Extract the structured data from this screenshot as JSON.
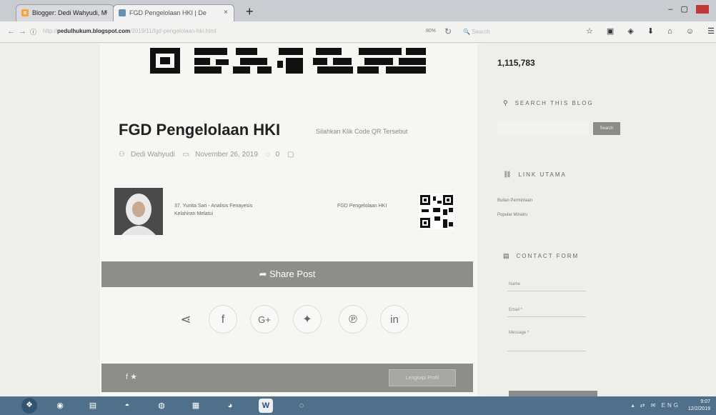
{
  "browser": {
    "tabs": [
      {
        "label": "Blogger: Dedi Wahyudi, M"
      },
      {
        "label": "FGD Pengelolaan HKI | De"
      }
    ],
    "new_tab": "+",
    "url_host": "pedulhukum.blogspot.com",
    "url_path": "/2019/11/fgd-pengelolaan-hki.html",
    "url_prefix": "http://",
    "zoom": "80%",
    "search_placeholder": "Search"
  },
  "post": {
    "title": "FGD Pengelolaan HKI",
    "qr_hint": "Silahkan Klik Code QR Tersebut",
    "author": "Dedi Wahyudi",
    "date": "November 26, 2019",
    "comments": "0",
    "related": [
      {
        "title": "37. Yunita Sari - Analisis Fenayesis Kelahiran Melatui"
      },
      {
        "title": "FGD Pengelolaan HKI"
      }
    ],
    "share_label": "Share Post",
    "profile_button": "Lengkapi Profil"
  },
  "share_icons": [
    {
      "name": "share-icon",
      "glyph": "<"
    },
    {
      "name": "facebook-icon",
      "glyph": "f"
    },
    {
      "name": "google-plus-icon",
      "glyph": "G+"
    },
    {
      "name": "twitter-icon",
      "glyph": "★"
    },
    {
      "name": "pinterest-icon",
      "glyph": "℗"
    },
    {
      "name": "linkedin-icon",
      "glyph": "in"
    }
  ],
  "footer_icons": "f ★",
  "sidebar": {
    "pageviews": "1,115,783",
    "search_heading": "SEARCH THIS BLOG",
    "search_button": "Search",
    "links_heading": "LINK UTAMA",
    "links": [
      "Bullan Permintaan",
      "Popular Minatru"
    ],
    "contact_heading": "CONTACT FORM",
    "form": {
      "name": "Name",
      "email": "Email *",
      "message": "Message *"
    }
  },
  "taskbar": {
    "clock_time": "9:07",
    "clock_date": "12/2/2019",
    "tray": "▴ ⇄ ✉ ENG"
  },
  "colors": {
    "share_bar": "#8d8d89",
    "taskbar": "#4f6f8a",
    "close": "#c1383a"
  }
}
